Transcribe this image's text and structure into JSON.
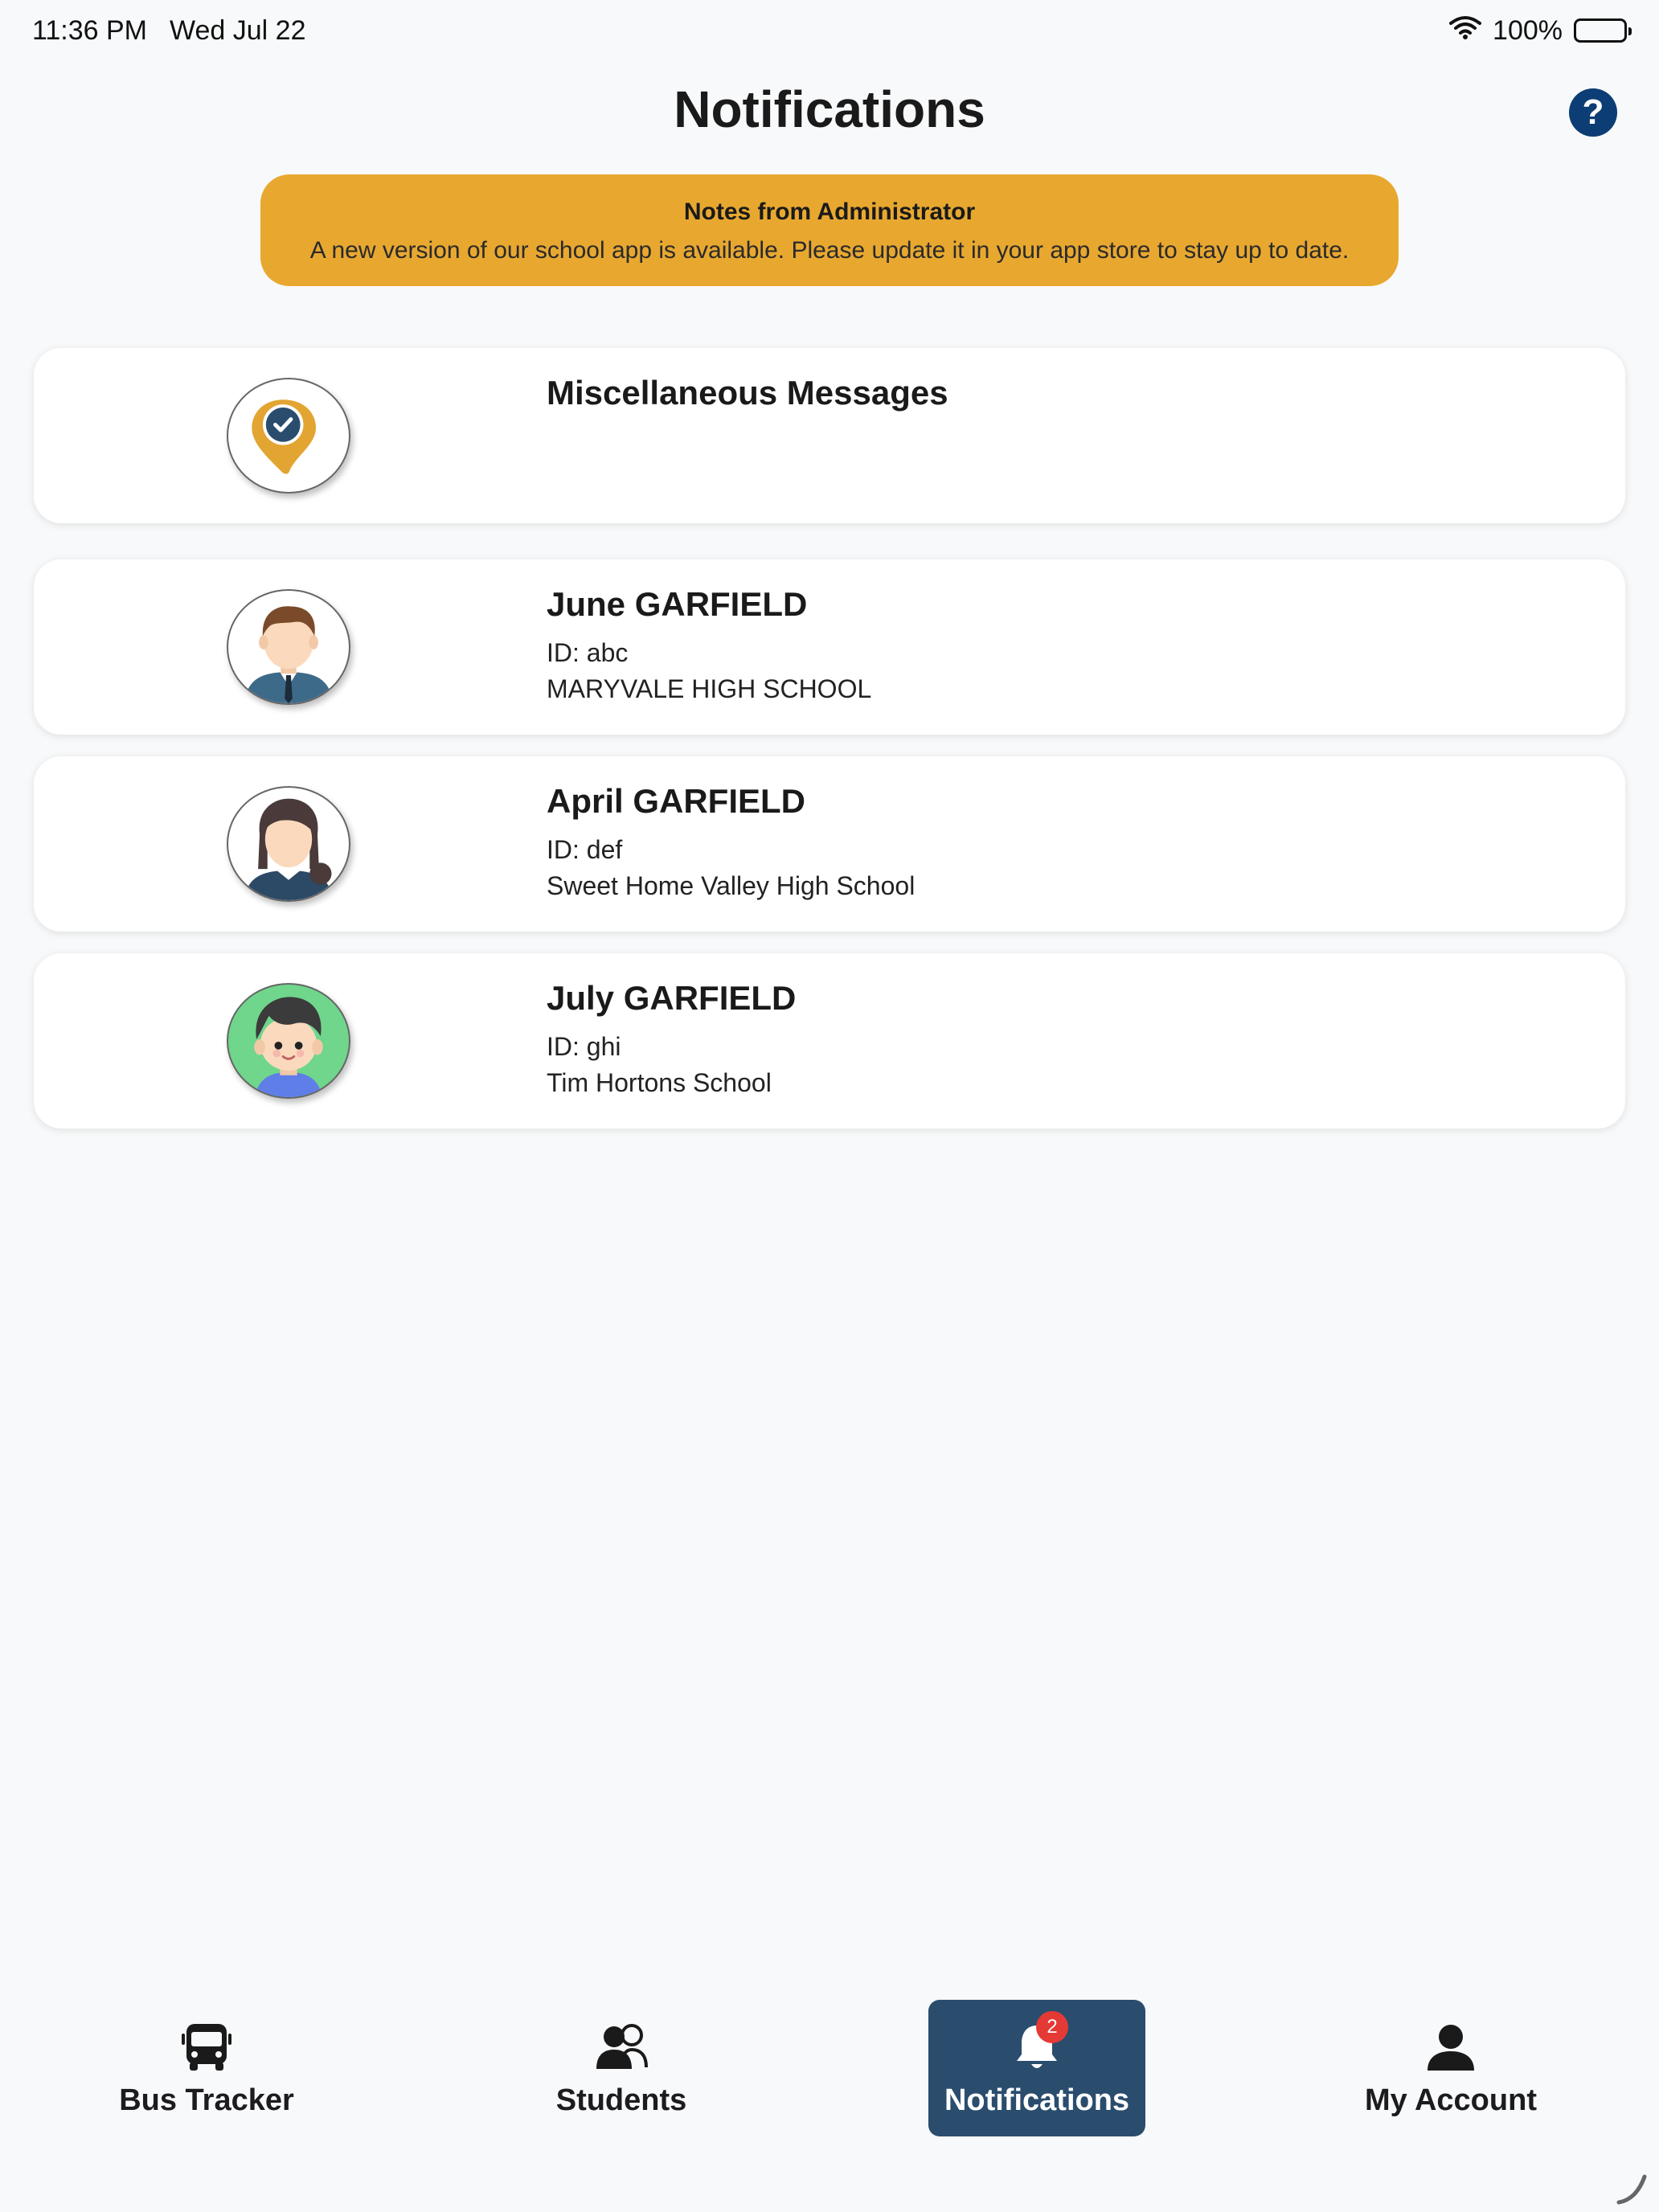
{
  "status_bar": {
    "time": "11:36 PM",
    "date": "Wed Jul 22",
    "battery": "100%"
  },
  "header": {
    "title": "Notifications",
    "help_label": "?"
  },
  "admin_banner": {
    "title": "Notes from Administrator",
    "text": "A new version of our school app is available. Please update it in your app store to stay up to date."
  },
  "cards": [
    {
      "name": "Miscellaneous Messages",
      "icon": "location-check-icon"
    },
    {
      "name": "June GARFIELD",
      "id": "ID: abc",
      "school": "MARYVALE HIGH SCHOOL",
      "icon": "boy-student-avatar"
    },
    {
      "name": "April GARFIELD",
      "id": "ID: def",
      "school": "Sweet Home Valley High School",
      "icon": "girl-student-avatar"
    },
    {
      "name": "July GARFIELD",
      "id": "ID: ghi",
      "school": "Tim Hortons School",
      "icon": "kid-avatar"
    }
  ],
  "bottom_nav": {
    "items": [
      {
        "label": "Bus Tracker",
        "icon": "bus-icon"
      },
      {
        "label": "Students",
        "icon": "students-icon"
      },
      {
        "label": "Notifications",
        "icon": "bell-icon",
        "badge": "2",
        "active": true
      },
      {
        "label": "My Account",
        "icon": "person-icon"
      }
    ]
  },
  "colors": {
    "banner": "#e8a830",
    "nav_active": "#2a4d6e",
    "help": "#0c3d74",
    "badge": "#e53935"
  }
}
